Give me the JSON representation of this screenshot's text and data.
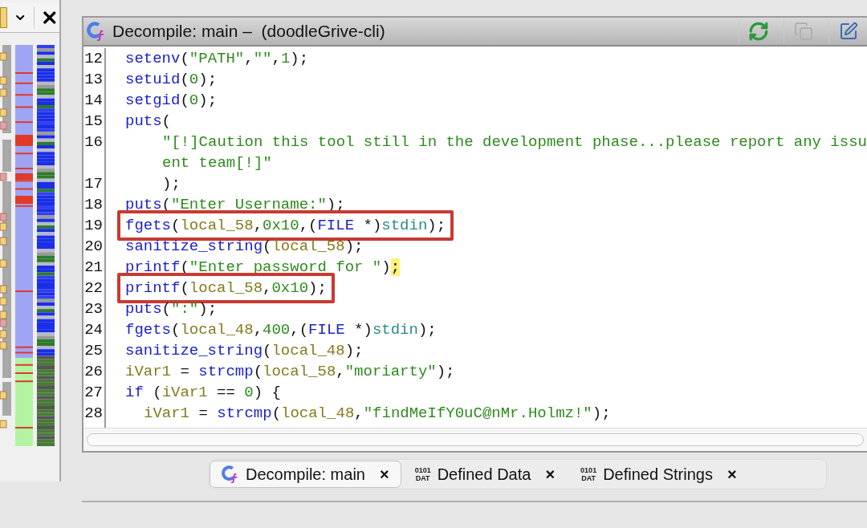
{
  "window": {
    "title": "Decompile: main –  (doodleGrive-cli)"
  },
  "code": {
    "lines": [
      {
        "number": "12",
        "boxed": false,
        "tokens": [
          {
            "text": "setenv",
            "kind": "fn"
          },
          {
            "text": "(",
            "kind": "plain"
          },
          {
            "text": "\"PATH\"",
            "kind": "str"
          },
          {
            "text": ",",
            "kind": "plain"
          },
          {
            "text": "\"\"",
            "kind": "str"
          },
          {
            "text": ",",
            "kind": "plain"
          },
          {
            "text": "1",
            "kind": "num"
          },
          {
            "text": ");",
            "kind": "plain"
          }
        ]
      },
      {
        "number": "13",
        "boxed": false,
        "tokens": [
          {
            "text": "setuid",
            "kind": "fn"
          },
          {
            "text": "(",
            "kind": "plain"
          },
          {
            "text": "0",
            "kind": "num"
          },
          {
            "text": ");",
            "kind": "plain"
          }
        ]
      },
      {
        "number": "14",
        "boxed": false,
        "tokens": [
          {
            "text": "setgid",
            "kind": "fn"
          },
          {
            "text": "(",
            "kind": "plain"
          },
          {
            "text": "0",
            "kind": "num"
          },
          {
            "text": ");",
            "kind": "plain"
          }
        ]
      },
      {
        "number": "15",
        "boxed": false,
        "tokens": [
          {
            "text": "puts",
            "kind": "fn"
          },
          {
            "text": "(",
            "kind": "plain"
          }
        ]
      },
      {
        "number": "16",
        "boxed": false,
        "indented": true,
        "tokens": [
          {
            "text": "\"[!]Caution this tool still in the development phase...please report any issu",
            "kind": "str"
          }
        ]
      },
      {
        "boxed": false,
        "indented": true,
        "tokens": [
          {
            "text": "ent team[!]\"",
            "kind": "str"
          }
        ]
      },
      {
        "number": "17",
        "boxed": false,
        "indented": true,
        "tokens": [
          {
            "text": ");",
            "kind": "plain"
          }
        ]
      },
      {
        "number": "18",
        "boxed": false,
        "tokens": [
          {
            "text": "puts",
            "kind": "fn"
          },
          {
            "text": "(",
            "kind": "plain"
          },
          {
            "text": "\"Enter Username:\"",
            "kind": "str"
          },
          {
            "text": ");",
            "kind": "plain"
          }
        ]
      },
      {
        "number": "19",
        "boxed": true,
        "tokens": [
          {
            "text": "fgets",
            "kind": "fn"
          },
          {
            "text": "(",
            "kind": "plain"
          },
          {
            "text": "local_58",
            "kind": "var"
          },
          {
            "text": ",",
            "kind": "plain"
          },
          {
            "text": "0x10",
            "kind": "num"
          },
          {
            "text": ",(",
            "kind": "plain"
          },
          {
            "text": "FILE",
            "kind": "type"
          },
          {
            "text": " *)",
            "kind": "plain"
          },
          {
            "text": "stdin",
            "kind": "global"
          },
          {
            "text": ");",
            "kind": "plain"
          }
        ]
      },
      {
        "number": "20",
        "boxed": false,
        "tokens": [
          {
            "text": "sanitize_string",
            "kind": "fn"
          },
          {
            "text": "(",
            "kind": "plain"
          },
          {
            "text": "local_58",
            "kind": "var"
          },
          {
            "text": ");",
            "kind": "plain"
          }
        ]
      },
      {
        "number": "21",
        "boxed": false,
        "tokens": [
          {
            "text": "printf",
            "kind": "fn"
          },
          {
            "text": "(",
            "kind": "plain"
          },
          {
            "text": "\"Enter password for \"",
            "kind": "str"
          },
          {
            "text": ")",
            "kind": "plain"
          },
          {
            "text": ";",
            "kind": "cursor"
          }
        ]
      },
      {
        "number": "22",
        "boxed": true,
        "tokens": [
          {
            "text": "printf",
            "kind": "fn"
          },
          {
            "text": "(",
            "kind": "plain"
          },
          {
            "text": "local_58",
            "kind": "var"
          },
          {
            "text": ",",
            "kind": "plain"
          },
          {
            "text": "0x10",
            "kind": "num"
          },
          {
            "text": ");",
            "kind": "plain"
          }
        ]
      },
      {
        "number": "23",
        "boxed": false,
        "tokens": [
          {
            "text": "puts",
            "kind": "fn"
          },
          {
            "text": "(",
            "kind": "plain"
          },
          {
            "text": "\":\"",
            "kind": "str"
          },
          {
            "text": ");",
            "kind": "plain"
          }
        ]
      },
      {
        "number": "24",
        "boxed": false,
        "tokens": [
          {
            "text": "fgets",
            "kind": "fn"
          },
          {
            "text": "(",
            "kind": "plain"
          },
          {
            "text": "local_48",
            "kind": "var"
          },
          {
            "text": ",",
            "kind": "plain"
          },
          {
            "text": "400",
            "kind": "num"
          },
          {
            "text": ",(",
            "kind": "plain"
          },
          {
            "text": "FILE",
            "kind": "type"
          },
          {
            "text": " *)",
            "kind": "plain"
          },
          {
            "text": "stdin",
            "kind": "global"
          },
          {
            "text": ");",
            "kind": "plain"
          }
        ]
      },
      {
        "number": "25",
        "boxed": false,
        "tokens": [
          {
            "text": "sanitize_string",
            "kind": "fn"
          },
          {
            "text": "(",
            "kind": "plain"
          },
          {
            "text": "local_48",
            "kind": "var"
          },
          {
            "text": ");",
            "kind": "plain"
          }
        ]
      },
      {
        "number": "26",
        "boxed": false,
        "tokens": [
          {
            "text": "iVar1",
            "kind": "var"
          },
          {
            "text": " = ",
            "kind": "plain"
          },
          {
            "text": "strcmp",
            "kind": "fn"
          },
          {
            "text": "(",
            "kind": "plain"
          },
          {
            "text": "local_58",
            "kind": "var"
          },
          {
            "text": ",",
            "kind": "plain"
          },
          {
            "text": "\"moriarty\"",
            "kind": "str"
          },
          {
            "text": ");",
            "kind": "plain"
          }
        ]
      },
      {
        "number": "27",
        "boxed": false,
        "tokens": [
          {
            "text": "if",
            "kind": "fn"
          },
          {
            "text": " (",
            "kind": "plain"
          },
          {
            "text": "iVar1",
            "kind": "var"
          },
          {
            "text": " == ",
            "kind": "plain"
          },
          {
            "text": "0",
            "kind": "num"
          },
          {
            "text": ") {",
            "kind": "plain"
          }
        ]
      },
      {
        "number": "28",
        "boxed": false,
        "indented": false,
        "nested": true,
        "tokens": [
          {
            "text": "iVar1",
            "kind": "var"
          },
          {
            "text": " = ",
            "kind": "plain"
          },
          {
            "text": "strcmp",
            "kind": "fn"
          },
          {
            "text": "(",
            "kind": "plain"
          },
          {
            "text": "local_48",
            "kind": "var"
          },
          {
            "text": ",",
            "kind": "plain"
          },
          {
            "text": "\"findMeIfY0uC@nMr.Holmz!\"",
            "kind": "str"
          },
          {
            "text": ");",
            "kind": "plain"
          }
        ]
      }
    ]
  },
  "tabs": [
    {
      "kind": "decompile",
      "label": "Decompile: main",
      "close": "×",
      "selected": true
    },
    {
      "kind": "data",
      "badge": [
        "0101",
        "DAT"
      ],
      "label": "Defined Data",
      "close": "×",
      "selected": false
    },
    {
      "kind": "data",
      "badge": [
        "0101",
        "DAT"
      ],
      "label": "Defined Strings",
      "close": "×",
      "selected": false
    }
  ]
}
